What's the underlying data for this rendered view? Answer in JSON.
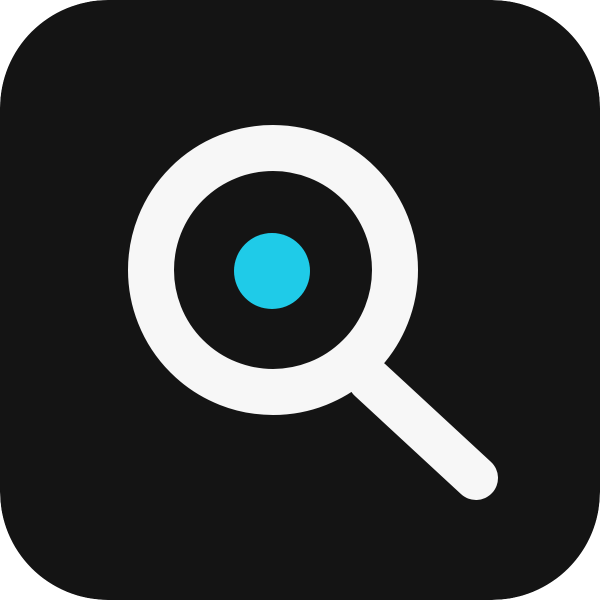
{
  "icon": {
    "name": "search-app-icon",
    "glyph": "magnifying-glass-icon",
    "colors": {
      "tile": "#141414",
      "glyph": "#f7f7f7",
      "lens_dot": "#1fcbe8"
    }
  }
}
